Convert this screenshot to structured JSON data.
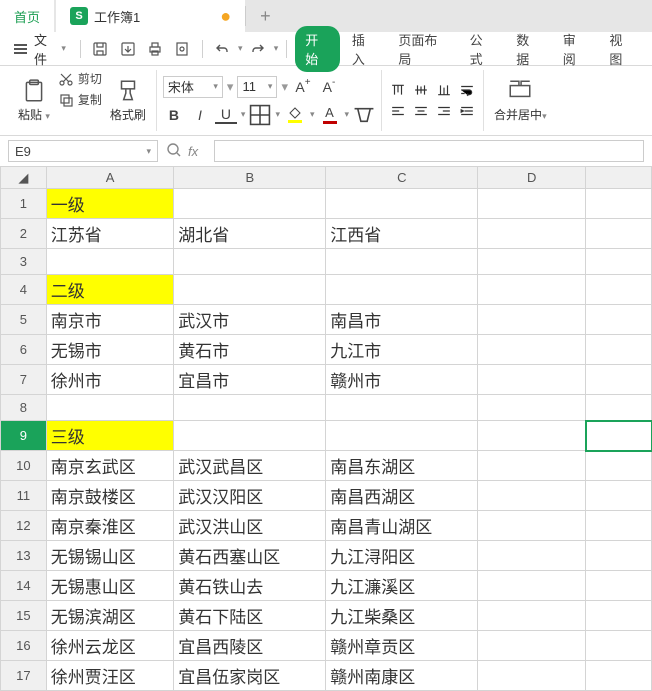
{
  "tabs": {
    "home": "首页",
    "doc_icon": "S",
    "doc_name": "工作簿1",
    "doc_dirty": "●",
    "plus": "+"
  },
  "menu": {
    "file": "文件",
    "ribbon_tabs": [
      "开始",
      "插入",
      "页面布局",
      "公式",
      "数据",
      "审阅",
      "视图"
    ],
    "active_ribbon": 0
  },
  "ribbon": {
    "cut": "剪切",
    "copy": "复制",
    "paste": "粘贴",
    "format_painter": "格式刷",
    "font_name": "宋体",
    "font_size": "11",
    "merge_center": "合并居中"
  },
  "formula": {
    "cell_ref": "E9",
    "fx_label": "fx",
    "value": ""
  },
  "columns": [
    "A",
    "B",
    "C",
    "D",
    ""
  ],
  "col_widths": [
    "col-A",
    "col-B",
    "col-C",
    "col-D",
    "col-E"
  ],
  "rows": [
    {
      "n": "1",
      "hl": true,
      "c": [
        "一级",
        "",
        "",
        "",
        ""
      ]
    },
    {
      "n": "2",
      "c": [
        "江苏省",
        "湖北省",
        "江西省",
        "",
        ""
      ]
    },
    {
      "n": "3",
      "c": [
        "",
        "",
        "",
        "",
        ""
      ]
    },
    {
      "n": "4",
      "hl": true,
      "c": [
        "二级",
        "",
        "",
        "",
        ""
      ]
    },
    {
      "n": "5",
      "c": [
        "南京市",
        "武汉市",
        "南昌市",
        "",
        ""
      ]
    },
    {
      "n": "6",
      "c": [
        "无锡市",
        "黄石市",
        "九江市",
        "",
        ""
      ]
    },
    {
      "n": "7",
      "c": [
        "徐州市",
        "宜昌市",
        "赣州市",
        "",
        ""
      ]
    },
    {
      "n": "8",
      "c": [
        "",
        "",
        "",
        "",
        ""
      ]
    },
    {
      "n": "9",
      "hl": true,
      "sel": true,
      "c": [
        "三级",
        "",
        "",
        "",
        ""
      ]
    },
    {
      "n": "10",
      "c": [
        "南京玄武区",
        "武汉武昌区",
        "南昌东湖区",
        "",
        ""
      ]
    },
    {
      "n": "11",
      "c": [
        "南京鼓楼区",
        "武汉汉阳区",
        "南昌西湖区",
        "",
        ""
      ]
    },
    {
      "n": "12",
      "c": [
        "南京秦淮区",
        "武汉洪山区",
        "南昌青山湖区",
        "",
        ""
      ]
    },
    {
      "n": "13",
      "c": [
        "无锡锡山区",
        "黄石西塞山区",
        "九江浔阳区",
        "",
        ""
      ]
    },
    {
      "n": "14",
      "c": [
        "无锡惠山区",
        "黄石铁山去",
        "九江濂溪区",
        "",
        ""
      ]
    },
    {
      "n": "15",
      "c": [
        "无锡滨湖区",
        "黄石下陆区",
        "九江柴桑区",
        "",
        ""
      ]
    },
    {
      "n": "16",
      "c": [
        "徐州云龙区",
        "宜昌西陵区",
        "赣州章贡区",
        "",
        ""
      ]
    },
    {
      "n": "17",
      "c": [
        "徐州贾汪区",
        "宜昌伍家岗区",
        "赣州南康区",
        "",
        ""
      ]
    }
  ],
  "selected_cell": {
    "row": 9,
    "col": 4
  }
}
